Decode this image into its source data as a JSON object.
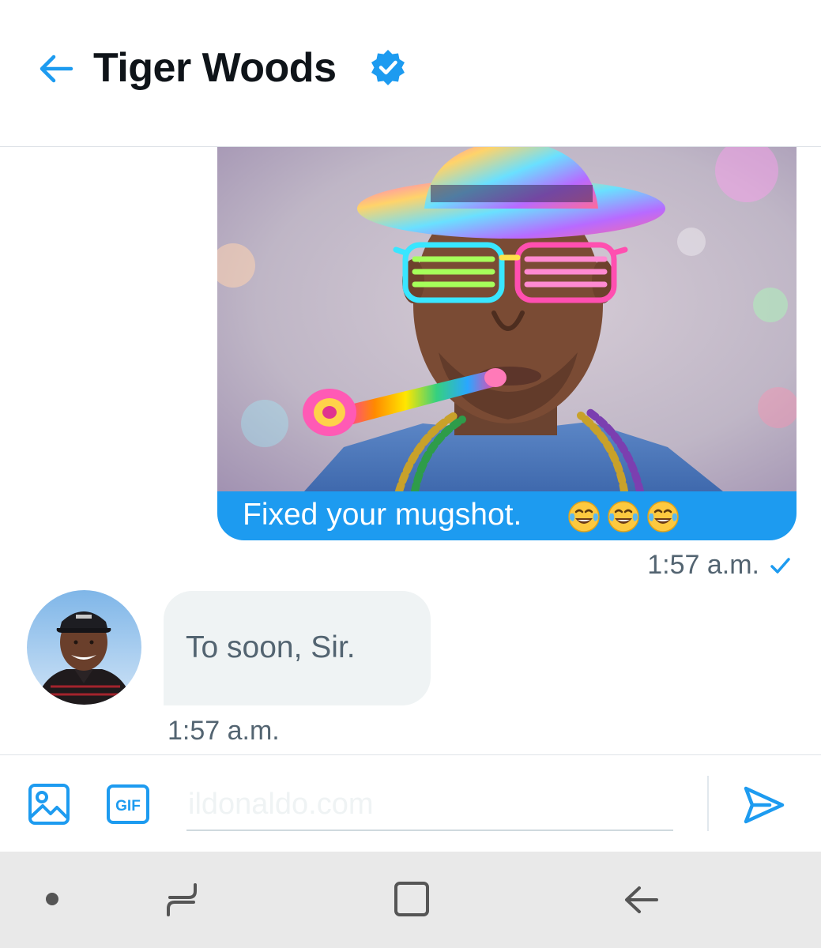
{
  "header": {
    "title": "Tiger Woods",
    "back_icon": "arrow-left-icon",
    "verified_icon": "verified-badge-icon",
    "accent": "#1d9bf0"
  },
  "messages": [
    {
      "direction": "sent",
      "media": "photo-of-man-in-party-hat-neon-glasses-and-party-blower",
      "text": "Fixed your mugshot.",
      "emoji": [
        "😂",
        "😂",
        "😂"
      ],
      "time": "1:57 a.m.",
      "status_icon": "check-icon"
    },
    {
      "direction": "received",
      "avatar": "avatar-photo",
      "text": "To soon, Sir.",
      "time": "1:57 a.m."
    }
  ],
  "composer": {
    "placeholder": "ildonaldo.com",
    "media_icon": "image-icon",
    "gif_label": "GIF",
    "send_icon": "send-icon"
  },
  "system_nav": {
    "icons": [
      "dot-icon",
      "recent-apps-icon",
      "home-icon",
      "back-icon"
    ]
  },
  "colors": {
    "accent": "#1d9bf0",
    "bubble_received": "#eff3f4",
    "muted_text": "#536471",
    "nav_bar": "#e9e9e9"
  }
}
